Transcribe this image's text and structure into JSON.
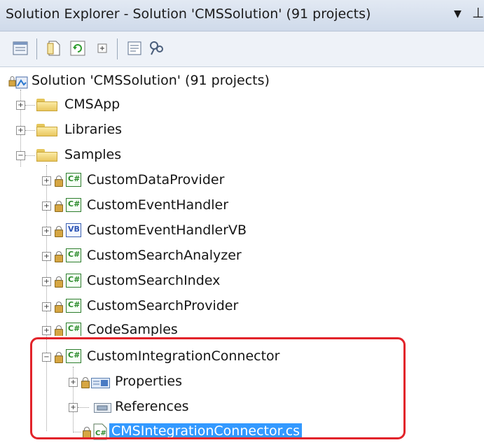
{
  "window": {
    "title": "Solution Explorer - Solution 'CMSSolution' (91 projects)",
    "dropdown_icon": "dropdown-arrow-icon",
    "pin_icon": "pin-icon"
  },
  "toolbar": {
    "icons": [
      "properties-icon",
      "show-all-files-icon",
      "refresh-icon",
      "collapse-icon",
      "view-class-diagram-icon",
      "find-icon"
    ]
  },
  "tree": {
    "solution": "Solution 'CMSSolution' (91 projects)",
    "folders": [
      {
        "label": "CMSApp",
        "expanded": false
      },
      {
        "label": "Libraries",
        "expanded": false
      },
      {
        "label": "Samples",
        "expanded": true
      }
    ],
    "projects": [
      {
        "label": "CustomDataProvider",
        "lang": "C#"
      },
      {
        "label": "CustomEventHandler",
        "lang": "C#"
      },
      {
        "label": "CustomEventHandlerVB",
        "lang": "VB"
      },
      {
        "label": "CustomSearchAnalyzer",
        "lang": "C#"
      },
      {
        "label": "CustomSearchIndex",
        "lang": "C#"
      },
      {
        "label": "CustomSearchProvider",
        "lang": "C#"
      },
      {
        "label": "CodeSamples",
        "lang": "C#"
      },
      {
        "label": "CustomIntegrationConnector",
        "lang": "C#"
      }
    ],
    "children": {
      "properties": "Properties",
      "references": "References",
      "file": "CMSIntegrationConnector.cs"
    }
  },
  "colors": {
    "highlight_border": "#e2232a",
    "selection": "#3399ff"
  }
}
